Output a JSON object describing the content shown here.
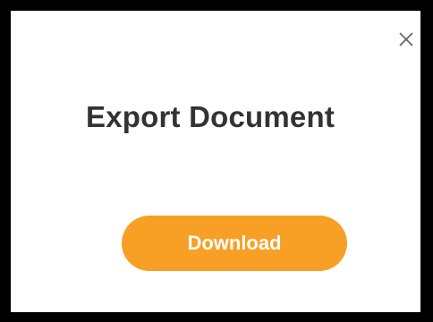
{
  "dialog": {
    "title": "Export Document",
    "close_icon": "close-icon",
    "download_label": "Download"
  },
  "colors": {
    "button_background": "#f7a025",
    "button_text": "#ffffff",
    "title_text": "#333333",
    "close_icon": "#666666"
  }
}
